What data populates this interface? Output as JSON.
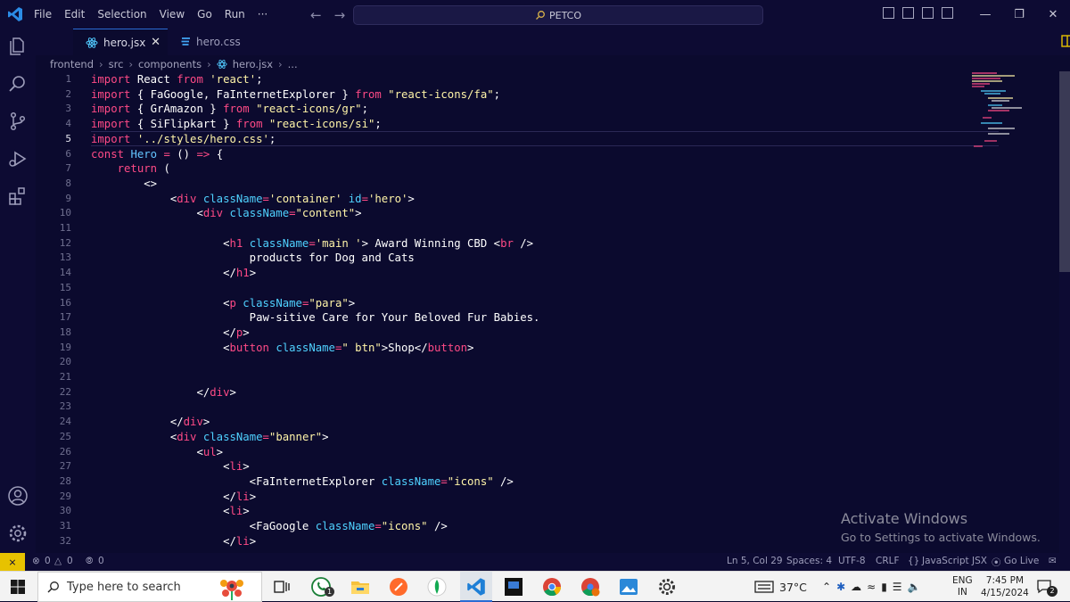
{
  "menu": [
    "File",
    "Edit",
    "Selection",
    "View",
    "Go",
    "Run",
    "···"
  ],
  "search_box": "PETCO",
  "tabs": [
    {
      "label": "hero.jsx",
      "close": "✕"
    },
    {
      "label": "hero.css"
    }
  ],
  "breadcrumb": [
    "frontend",
    "src",
    "components",
    "hero.jsx",
    "..."
  ],
  "code_lines": [
    {
      "n": "1",
      "html": "<span class='kw'>import</span> React <span class='kw'>from</span> <span class='str'>'react'</span>;"
    },
    {
      "n": "2",
      "html": "<span class='kw'>import</span> { FaGoogle, FaInternetExplorer } <span class='kw'>from</span> <span class='str'>\"react-icons/fa\"</span>;"
    },
    {
      "n": "3",
      "html": "<span class='kw'>import</span> { GrAmazon } <span class='kw'>from</span> <span class='str'>\"react-icons/gr\"</span>;"
    },
    {
      "n": "4",
      "html": "<span class='kw'>import</span> { SiFlipkart } <span class='kw'>from</span> <span class='str'>\"react-icons/si\"</span>;"
    },
    {
      "n": "5",
      "html": "<span class='kw'>import</span> <span class='str'>'../styles/hero.css'</span>;"
    },
    {
      "n": "6",
      "html": "<span class='kw'>const</span> <span class='fn'>Hero</span> <span class='kw'>=</span> () <span class='kw'>=&gt;</span> {"
    },
    {
      "n": "7",
      "html": "    <span class='kw'>return</span> ("
    },
    {
      "n": "8",
      "html": "        &lt;&gt;"
    },
    {
      "n": "9",
      "html": "            &lt;<span class='tag'>div</span> <span class='attr'>className</span><span class='kw'>=</span><span class='str'>'container'</span> <span class='attr'>id</span><span class='kw'>=</span><span class='str'>'hero'</span>&gt;"
    },
    {
      "n": "10",
      "html": "                &lt;<span class='tag'>div</span> <span class='attr'>className</span><span class='kw'>=</span><span class='str'>\"content\"</span>&gt;"
    },
    {
      "n": "11",
      "html": ""
    },
    {
      "n": "12",
      "html": "                    &lt;<span class='tag'>h1</span> <span class='attr'>className</span><span class='kw'>=</span><span class='str'>'main '</span>&gt; Award Winning CBD &lt;<span class='tag'>br</span> /&gt;"
    },
    {
      "n": "13",
      "html": "                        products for Dog and Cats"
    },
    {
      "n": "14",
      "html": "                    &lt;/<span class='tag'>h1</span>&gt;"
    },
    {
      "n": "15",
      "html": ""
    },
    {
      "n": "16",
      "html": "                    &lt;<span class='tag'>p</span> <span class='attr'>className</span><span class='kw'>=</span><span class='str'>\"para\"</span>&gt;"
    },
    {
      "n": "17",
      "html": "                        Paw-sitive Care for Your Beloved Fur Babies."
    },
    {
      "n": "18",
      "html": "                    &lt;/<span class='tag'>p</span>&gt;"
    },
    {
      "n": "19",
      "html": "                    &lt;<span class='tag'>button</span> <span class='attr'>className</span><span class='kw'>=</span><span class='str'>\" btn\"</span>&gt;Shop&lt;/<span class='tag'>button</span>&gt;"
    },
    {
      "n": "20",
      "html": ""
    },
    {
      "n": "21",
      "html": ""
    },
    {
      "n": "22",
      "html": "                &lt;/<span class='tag'>div</span>&gt;"
    },
    {
      "n": "23",
      "html": ""
    },
    {
      "n": "24",
      "html": "            &lt;/<span class='tag'>div</span>&gt;"
    },
    {
      "n": "25",
      "html": "            &lt;<span class='tag'>div</span> <span class='attr'>className</span><span class='kw'>=</span><span class='str'>\"banner\"</span>&gt;"
    },
    {
      "n": "26",
      "html": "                &lt;<span class='tag'>ul</span>&gt;"
    },
    {
      "n": "27",
      "html": "                    &lt;<span class='tag'>li</span>&gt;"
    },
    {
      "n": "28",
      "html": "                        &lt;FaInternetExplorer <span class='attr'>className</span><span class='kw'>=</span><span class='str'>\"icons\"</span> /&gt;"
    },
    {
      "n": "29",
      "html": "                    &lt;/<span class='tag'>li</span>&gt;"
    },
    {
      "n": "30",
      "html": "                    &lt;<span class='tag'>li</span>&gt;"
    },
    {
      "n": "31",
      "html": "                        &lt;FaGoogle <span class='attr'>className</span><span class='kw'>=</span><span class='str'>\"icons\"</span> /&gt;"
    },
    {
      "n": "32",
      "html": "                    &lt;/<span class='tag'>li</span>&gt;"
    }
  ],
  "watermark": {
    "title": "Activate Windows",
    "subtitle": "Go to Settings to activate Windows."
  },
  "status": {
    "errors": "0",
    "warnings": "0",
    "ports": "0",
    "position": "Ln 5, Col 29",
    "spaces": "Spaces: 4",
    "encoding": "UTF-8",
    "eol": "CRLF",
    "language": "JavaScript JSX",
    "golive": "Go Live"
  },
  "taskbar": {
    "search_placeholder": "Type here to search",
    "weather": "37°C",
    "lang_top": "ENG",
    "lang_bottom": "IN",
    "time": "7:45 PM",
    "date": "4/15/2024",
    "notif_count": "2",
    "whatsapp_badge": "1"
  },
  "colors": {
    "bg": "#0b0a2e",
    "keyword": "#ff4a86",
    "string": "#fff4a8",
    "attribute": "#4fd1ff",
    "status_remote": "#e7c200"
  }
}
